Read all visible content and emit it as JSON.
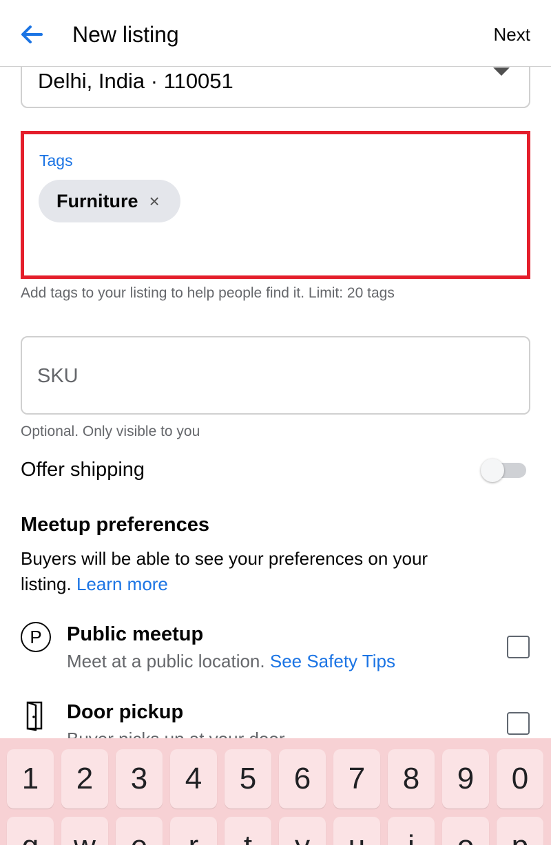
{
  "header": {
    "title": "New listing",
    "next_label": "Next"
  },
  "location": {
    "value": "Delhi, India · 110051"
  },
  "tags": {
    "label": "Tags",
    "items": [
      "Furniture"
    ],
    "remove_glyph": "×",
    "helper": "Add tags to your listing to help people find it. Limit: 20 tags",
    "highlight_color": "#e41e2b"
  },
  "sku": {
    "placeholder": "SKU",
    "value": "",
    "helper": "Optional. Only visible to you"
  },
  "shipping": {
    "label": "Offer shipping",
    "enabled": false
  },
  "meetup": {
    "title": "Meetup preferences",
    "description": "Buyers will be able to see your preferences on your listing.",
    "learn_more": "Learn more",
    "options": [
      {
        "icon": "parking-icon",
        "icon_glyph": "P",
        "title": "Public meetup",
        "subtitle": "Meet at a public location.",
        "link": "See Safety Tips",
        "checked": false
      },
      {
        "icon": "door-icon",
        "title": "Door pickup",
        "subtitle": "Buyer picks up at your door",
        "checked": false
      }
    ]
  },
  "keyboard": {
    "number_row": [
      "1",
      "2",
      "3",
      "4",
      "5",
      "6",
      "7",
      "8",
      "9",
      "0"
    ],
    "letter_row": [
      "q",
      "w",
      "e",
      "r",
      "t",
      "y",
      "u",
      "i",
      "o",
      "p"
    ]
  },
  "colors": {
    "accent": "#1b74e4",
    "secondary_text": "#65676b",
    "keyboard_bg": "#f7d1d4"
  }
}
